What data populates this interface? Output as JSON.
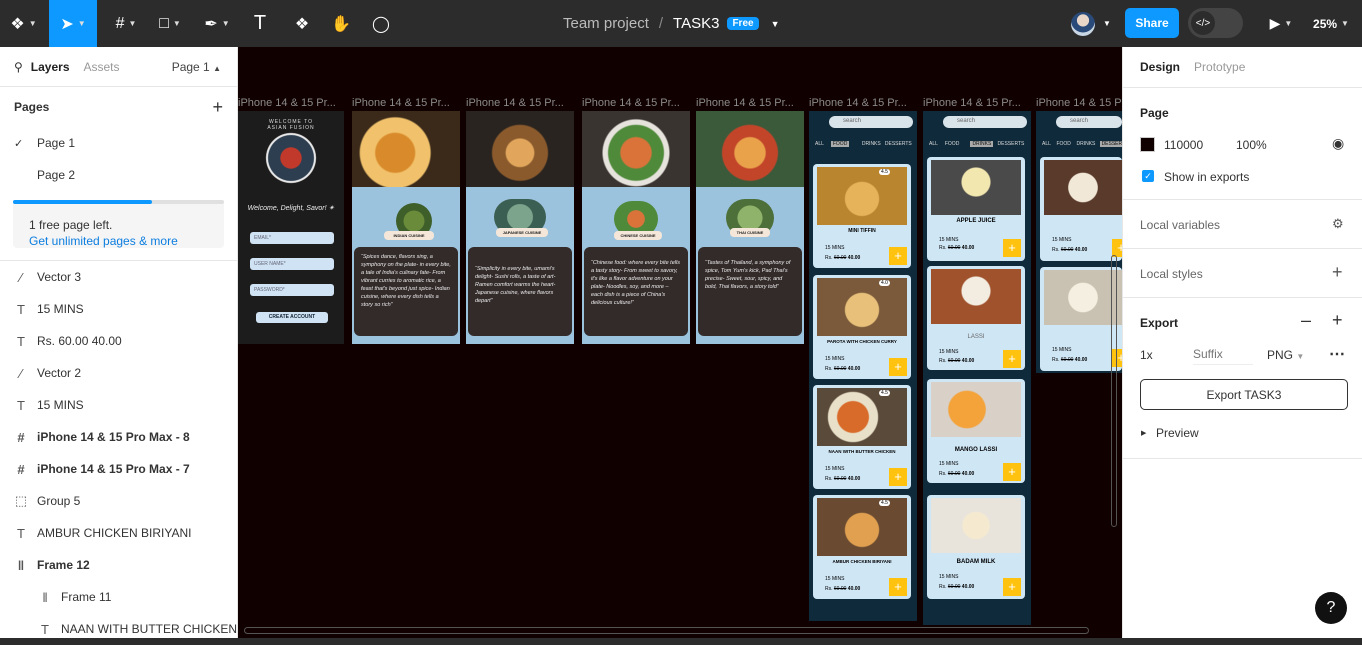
{
  "toolbar": {
    "title_team": "Team project",
    "title_sep": "/",
    "file_name": "TASK3",
    "plan_badge": "Free",
    "share_label": "Share",
    "zoom": "25%"
  },
  "left_panel": {
    "tab_layers": "Layers",
    "tab_assets": "Assets",
    "page_selector": "Page 1",
    "pages_header": "Pages",
    "pages": [
      "Page 1",
      "Page 2"
    ],
    "quota_text": "1 free page left.",
    "quota_link": "Get unlimited pages & more",
    "quota_progress": 0.66,
    "layers": [
      {
        "icon": "vector-icon",
        "label": "Vector 3"
      },
      {
        "icon": "text-icon",
        "label": "15 MINS"
      },
      {
        "icon": "text-icon",
        "label": "Rs. 60.00 40.00"
      },
      {
        "icon": "vector-icon",
        "label": "Vector 2"
      },
      {
        "icon": "text-icon",
        "label": "15 MINS"
      },
      {
        "icon": "frame-icon",
        "label": "iPhone 14 & 15 Pro Max - 8"
      },
      {
        "icon": "frame-icon",
        "label": "iPhone 14 & 15 Pro Max - 7"
      },
      {
        "icon": "group-icon",
        "label": "Group 5"
      },
      {
        "icon": "text-icon",
        "label": "AMBUR CHICKEN BIRIYANI"
      },
      {
        "icon": "autolayout-icon",
        "label": "Frame 12"
      },
      {
        "icon": "autolayout-icon",
        "label": "Frame 11"
      },
      {
        "icon": "text-icon",
        "label": "NAAN WITH BUTTER CHICKEN"
      }
    ]
  },
  "canvas": {
    "frame_label": "iPhone 14 & 15 Pr...",
    "welcome": {
      "logo_text": "WELCOME TO ASIAN FUSION",
      "tagline": "Welcome, Delight, Savor! ✴",
      "email": "EMAIL*",
      "username": "USER NAME*",
      "password": "PASSWORD*",
      "create": "CREATE ACCOUNT"
    },
    "cuisines": [
      {
        "badge": "INDIAN CUISINE",
        "quote": "“Spices dance, flavors sing, a symphony on the plate- in every bite, a tale of India's culinary fate- From vibrant curries to aromatic rice, a feast that's beyond just spice- Indian cuisine, where every dish tells a story so rich”"
      },
      {
        "badge": "JAPANESE CUISINE",
        "quote": "“Simplicity in every bite, umami's delight- Sushi rolls, a taste of art- Ramen comfort warms the heart- Japanese cuisine, where flavors depart”"
      },
      {
        "badge": "CHINESE CUISINE",
        "quote": "“Chinese food: where every bite tells a tasty story- From sweet to savory, it's like a flavor adventure on your plate- Noodles, soy, and more – each dish is a piece of China's delicious culture!”"
      },
      {
        "badge": "THAI CUISINE",
        "quote": "“Tastes of Thailand, a symphony of spice, Tom Yum's kick, Pad Thai's precise- Sweet, sour, spicy, and bold, Thai flavors, a story told”"
      }
    ],
    "menu": {
      "search": "search",
      "tabs": [
        "ALL",
        "FOOD",
        "DRINKS",
        "DESSERTS"
      ],
      "time": "15 MINS",
      "old_price": "60.00",
      "price": "40.00",
      "rs": "Rs.",
      "plus": "+",
      "food": [
        {
          "name": "MINI TIFFIN",
          "rating": "4.5"
        },
        {
          "name": "PAROTA WITH CHICKEN CURRY",
          "rating": "4.0"
        },
        {
          "name": "NAAN WITH BUTTER CHICKEN",
          "rating": "4.5"
        },
        {
          "name": "AMBUR CHICKEN BIRIYANI",
          "rating": "4.5"
        }
      ],
      "drinks": [
        {
          "name": "APPLE JUICE"
        },
        {
          "name": "LASSI"
        },
        {
          "name": "MANGO LASSI"
        },
        {
          "name": "BADAM MILK"
        }
      ]
    }
  },
  "right_panel": {
    "tab_design": "Design",
    "tab_prototype": "Prototype",
    "page_header": "Page",
    "bg_hex": "110000",
    "bg_opacity": "100%",
    "show_exports": "Show in exports",
    "local_variables": "Local variables",
    "local_styles": "Local styles",
    "export_header": "Export",
    "export_scale": "1x",
    "export_suffix_placeholder": "Suffix",
    "export_format": "PNG",
    "export_button": "Export TASK3",
    "preview": "Preview"
  },
  "colors": {
    "accent": "#0d99ff",
    "canvas_bg": "#110000",
    "menu_card": "#cfe6f5",
    "menu_bg": "#0f2a3a",
    "plus_btn": "#ffc20e"
  }
}
